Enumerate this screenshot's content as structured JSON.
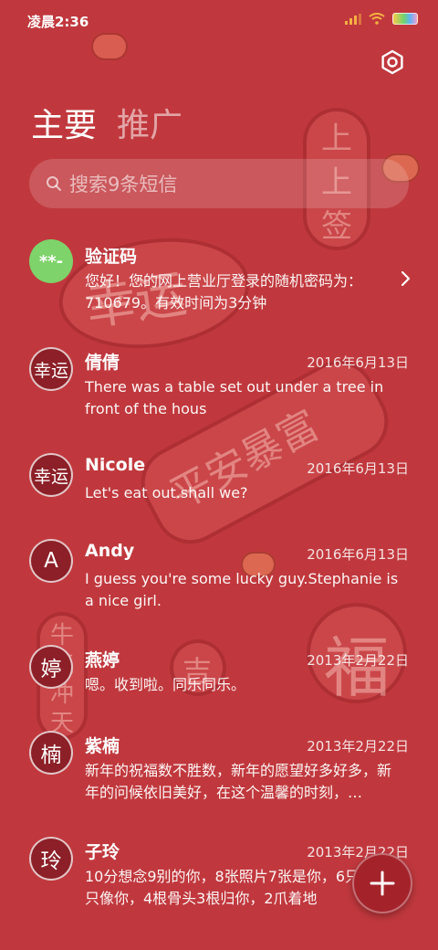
{
  "status_bar": {
    "time": "凌晨2:36"
  },
  "tabs": [
    {
      "label": "主要"
    },
    {
      "label": "推广"
    }
  ],
  "search": {
    "placeholder": "搜索9条短信"
  },
  "conversations": [
    {
      "avatar": "**-",
      "name": "验证码",
      "date": "",
      "preview": "您好！您的网上营业厅登录的随机密码为：710679。有效时间为3分钟"
    },
    {
      "avatar": "幸运",
      "name": "倩倩",
      "date": "2016年6月13日",
      "preview": "There was a table set out under a tree in front of the hous"
    },
    {
      "avatar": "幸运",
      "name": "Nicole",
      "date": "2016年6月13日",
      "preview": "Let's eat out.shall we?"
    },
    {
      "avatar": "A",
      "name": "Andy",
      "date": "2016年6月13日",
      "preview": "I guess you're some lucky guy.Stephanie is a nice girl."
    },
    {
      "avatar": "婷",
      "name": "燕婷",
      "date": "2013年2月22日",
      "preview": "嗯。收到啦。同乐同乐。"
    },
    {
      "avatar": "楠",
      "name": "紫楠",
      "date": "2013年2月22日",
      "preview": "新年的祝福数不胜数，新年的愿望好多好多，新年的问候依旧美好，在这个温馨的时刻，…"
    },
    {
      "avatar": "玲",
      "name": "子玲",
      "date": "2013年2月22日",
      "preview": "10分想念9别的你，8张照片7张是你，6只小狗5只像你，4根骨头3根归你，2爪着地"
    }
  ],
  "decor": {
    "stamp_1": "上上签",
    "stamp_2": "幸运",
    "stamp_3": "平安暴富",
    "stamp_4": "福",
    "stamp_5": "吉",
    "stamp_6": "牛气冲天"
  },
  "icons": {
    "settings": "gear-icon",
    "search": "search-icon",
    "chevron": "chevron-right-icon",
    "compose": "plus-icon"
  },
  "colors": {
    "background": "#c0383d",
    "avatar_dark": "#8c1f27",
    "avatar_verification": "#7ed36a",
    "fab": "#a4232b"
  }
}
